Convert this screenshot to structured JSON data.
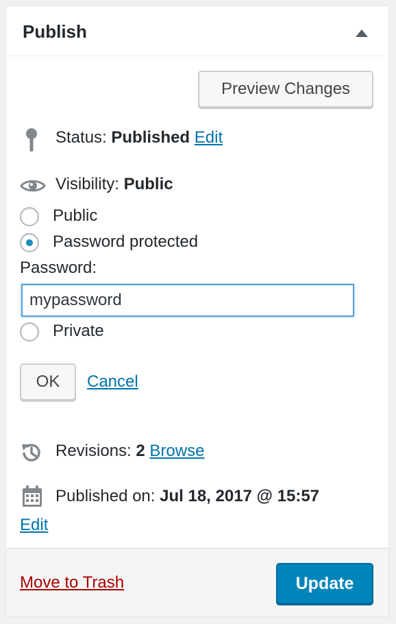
{
  "panel": {
    "title": "Publish"
  },
  "preview_button": "Preview Changes",
  "status": {
    "label": "Status:",
    "value": "Published",
    "edit_link": "Edit"
  },
  "visibility": {
    "label": "Visibility:",
    "value": "Public",
    "options": [
      {
        "label": "Public",
        "checked": false
      },
      {
        "label": "Password protected",
        "checked": true
      },
      {
        "label": "Private",
        "checked": false
      }
    ],
    "password_label": "Password:",
    "password_value": "mypassword",
    "ok_button": "OK",
    "cancel_link": "Cancel"
  },
  "revisions": {
    "label": "Revisions:",
    "count": "2",
    "browse_link": "Browse"
  },
  "published_on": {
    "label": "Published on:",
    "value": "Jul 18, 2017 @ 15:57",
    "edit_link": "Edit"
  },
  "footer": {
    "trash_link": "Move to Trash",
    "update_button": "Update"
  },
  "colors": {
    "link": "#0073aa",
    "trash": "#aa0000",
    "primary_button": "#0085ba",
    "radio_checked": "#1e8cbe"
  }
}
